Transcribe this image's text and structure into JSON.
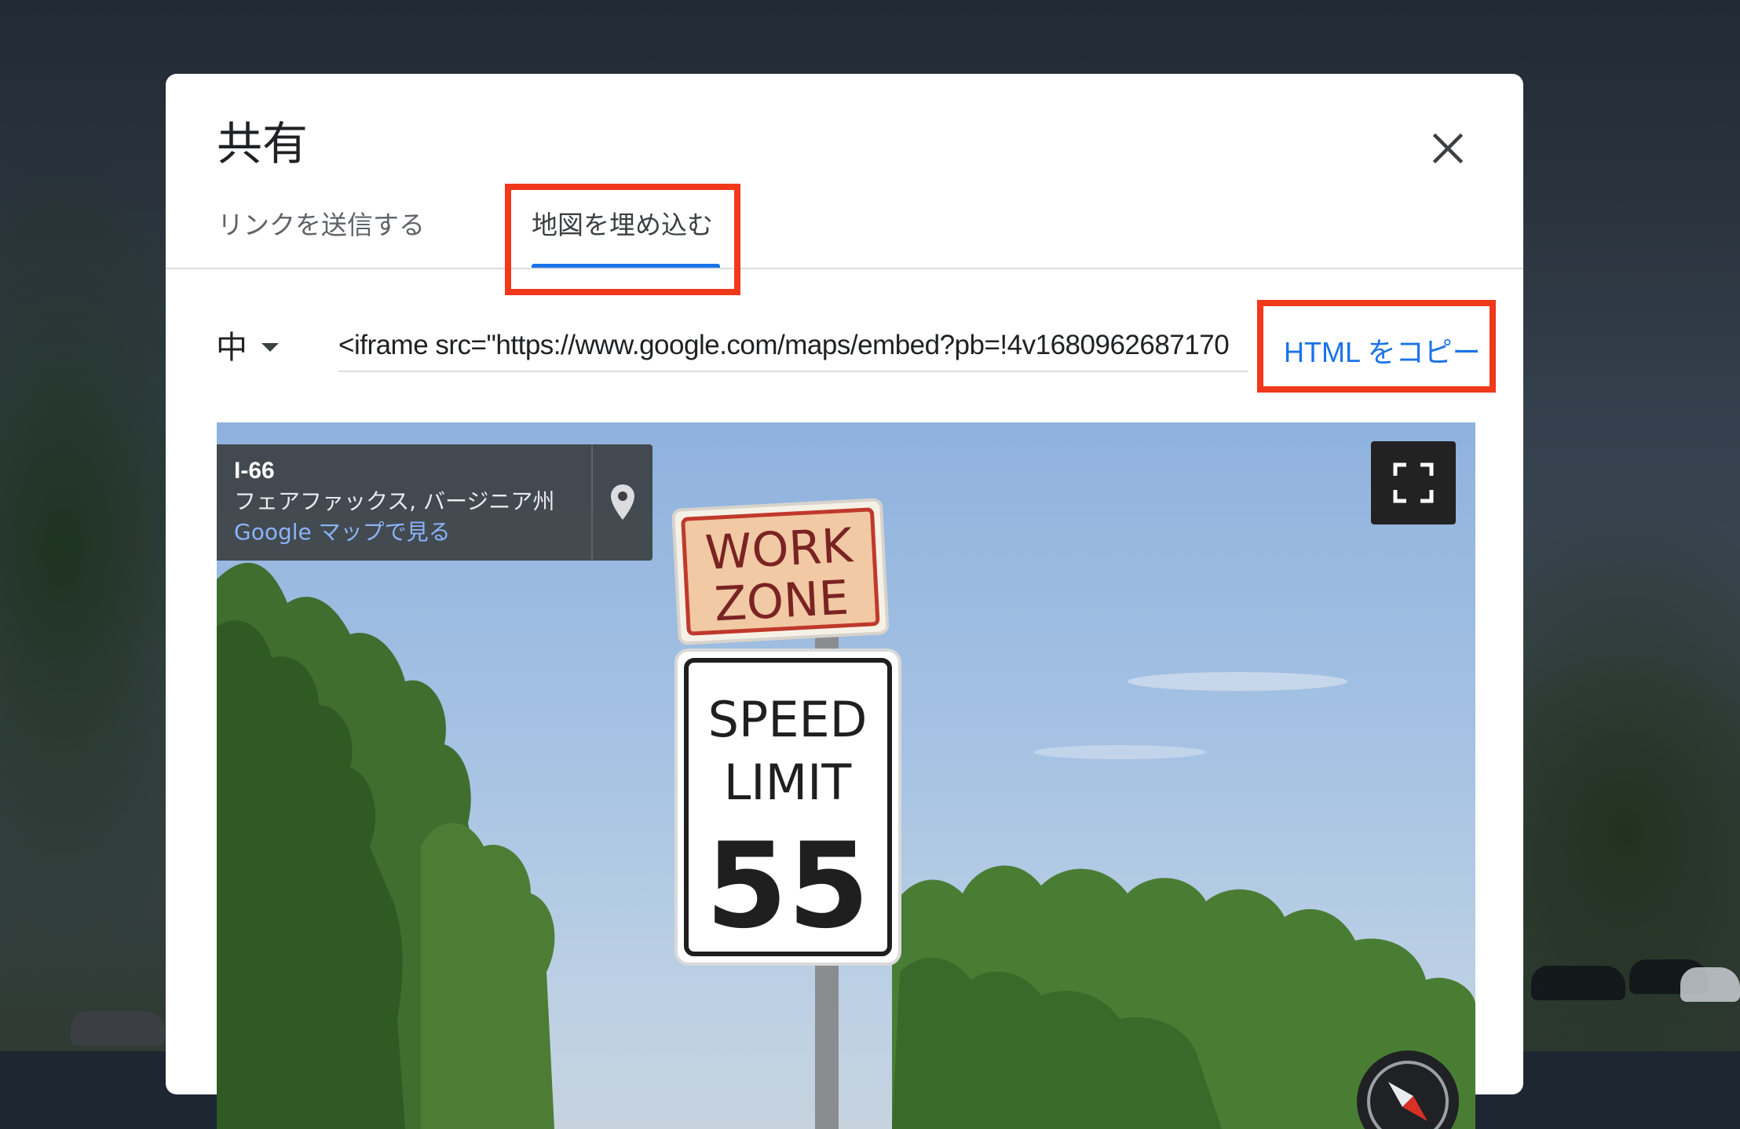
{
  "dialog": {
    "title": "共有",
    "tabs": [
      {
        "label": "リンクを送信する",
        "active": false
      },
      {
        "label": "地図を埋め込む",
        "active": true
      }
    ],
    "size_select": {
      "value": "中"
    },
    "embed_code": "<iframe src=\"https://www.google.com/maps/embed?pb=!4v1680962687170",
    "copy_html_label": "HTML をコピー"
  },
  "preview": {
    "location_title": "I-66",
    "location_subtitle": "フェアファックス, バージニア州",
    "open_in_maps_label": "Google マップで見る",
    "sign_top_line1": "WORK",
    "sign_top_line2": "ZONE",
    "sign_line1": "SPEED",
    "sign_line2": "LIMIT",
    "sign_value": "55"
  },
  "colors": {
    "accent": "#1a73e8",
    "highlight": "#f0381a",
    "link_on_dark": "#8ab4f8"
  },
  "icons": [
    "close-icon",
    "dropdown-caret-icon",
    "map-pin-icon",
    "fullscreen-icon",
    "compass-icon"
  ]
}
